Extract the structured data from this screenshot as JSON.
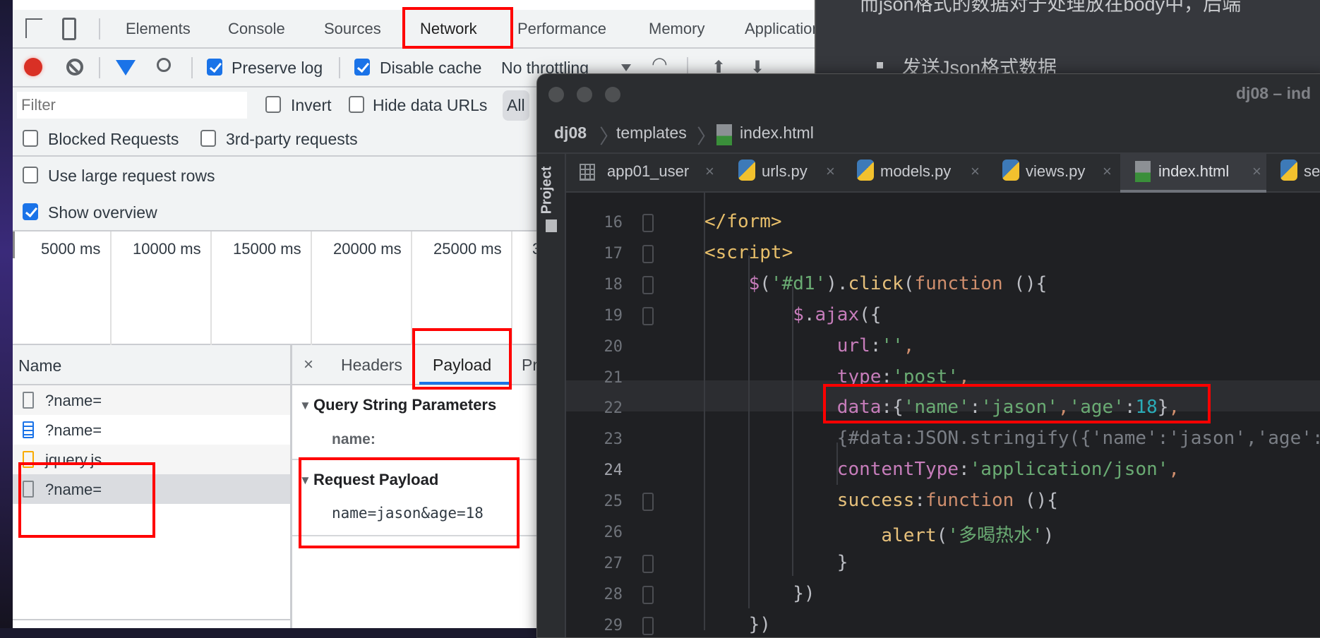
{
  "devtools": {
    "tabs": [
      "Elements",
      "Console",
      "Sources",
      "Network",
      "Performance",
      "Memory",
      "Application"
    ],
    "active_tab": "Network",
    "toolbar": {
      "preserve_log": "Preserve log",
      "preserve_log_checked": true,
      "disable_cache": "Disable cache",
      "disable_cache_checked": true,
      "throttling": "No throttling"
    },
    "filter": {
      "placeholder": "Filter",
      "invert": "Invert",
      "hide_data_urls": "Hide data URLs",
      "all": "All"
    },
    "options": {
      "blocked": "Blocked Requests",
      "third_party": "3rd-party requests",
      "large_rows": "Use large request rows",
      "show_overview": "Show overview",
      "show_overview_checked": true
    },
    "timeline_ticks": [
      "5000 ms",
      "10000 ms",
      "15000 ms",
      "20000 ms",
      "25000 ms",
      "3"
    ],
    "name_header": "Name",
    "requests": [
      {
        "name": "?name=",
        "icon": "document-icon"
      },
      {
        "name": "?name=",
        "icon": "html-document-icon"
      },
      {
        "name": "jquery.js",
        "icon": "script-icon"
      },
      {
        "name": "?name=",
        "icon": "document-icon",
        "selected": true
      }
    ],
    "detail_tabs": [
      "Headers",
      "Payload",
      "Pr"
    ],
    "active_detail_tab": "Payload",
    "query_section": "Query String Parameters",
    "query_param": "name:",
    "payload_section": "Request Payload",
    "payload_value": "name=jason&age=18"
  },
  "doc": {
    "line1": "而json格式的数据对于处理放在body中，后端",
    "bullet": "发送Json格式数据"
  },
  "ide": {
    "title": "dj08 – ind",
    "breadcrumb": [
      "dj08",
      "templates",
      "index.html"
    ],
    "project_label": "Project",
    "tabs": [
      "app01_user",
      "urls.py",
      "models.py",
      "views.py",
      "index.html",
      "se"
    ],
    "active_tab": "index.html",
    "current_line": 24,
    "lines": [
      {
        "n": "16",
        "indent": 0,
        "tokens": [
          [
            "t-tag",
            "</form>"
          ]
        ]
      },
      {
        "n": "17",
        "indent": 0,
        "tokens": [
          [
            "t-tag",
            "<script>"
          ]
        ]
      },
      {
        "n": "18",
        "indent": 4,
        "tokens": [
          [
            "t-prop",
            "$"
          ],
          [
            "t-p",
            "("
          ],
          [
            "t-str",
            "'#d1'"
          ],
          [
            "t-p",
            ")."
          ],
          [
            "t-fn",
            "click"
          ],
          [
            "t-p",
            "("
          ],
          [
            "t-kw",
            "function"
          ],
          [
            "t-p",
            " (){"
          ]
        ]
      },
      {
        "n": "19",
        "indent": 8,
        "tokens": [
          [
            "t-prop",
            "$"
          ],
          [
            "t-p",
            "."
          ],
          [
            "t-prop",
            "ajax"
          ],
          [
            "t-p",
            "({"
          ]
        ]
      },
      {
        "n": "20",
        "indent": 12,
        "tokens": [
          [
            "t-prop",
            "url"
          ],
          [
            "t-p",
            ":"
          ],
          [
            "t-str",
            "''"
          ],
          [
            "t-kw",
            ","
          ]
        ]
      },
      {
        "n": "21",
        "indent": 12,
        "tokens": [
          [
            "t-prop",
            "type"
          ],
          [
            "t-p",
            ":"
          ],
          [
            "t-str",
            "'post'"
          ],
          [
            "t-kw",
            ","
          ]
        ]
      },
      {
        "n": "22",
        "indent": 12,
        "tokens": [
          [
            "t-prop",
            "data"
          ],
          [
            "t-p",
            ":{"
          ],
          [
            "t-str",
            "'name'"
          ],
          [
            "t-p",
            ":"
          ],
          [
            "t-str",
            "'jason'"
          ],
          [
            "t-kw",
            ","
          ],
          [
            "t-str",
            "'age'"
          ],
          [
            "t-p",
            ":"
          ],
          [
            "t-num",
            "18"
          ],
          [
            "t-p",
            "}"
          ],
          [
            "t-kw",
            ","
          ]
        ]
      },
      {
        "n": "23",
        "indent": 12,
        "tokens": [
          [
            "t-cm",
            "{#data:JSON.stringify({'name':'jason','age':"
          ]
        ]
      },
      {
        "n": "24",
        "indent": 12,
        "tokens": [
          [
            "t-prop",
            "contentType"
          ],
          [
            "t-p",
            ":"
          ],
          [
            "t-str",
            "'application/json'"
          ],
          [
            "t-kw",
            ","
          ]
        ]
      },
      {
        "n": "25",
        "indent": 12,
        "tokens": [
          [
            "t-fn",
            "success"
          ],
          [
            "t-p",
            ":"
          ],
          [
            "t-kw",
            "function"
          ],
          [
            "t-p",
            " (){"
          ]
        ]
      },
      {
        "n": "26",
        "indent": 16,
        "tokens": [
          [
            "t-fn",
            "alert"
          ],
          [
            "t-p",
            "("
          ],
          [
            "t-str",
            "'多喝热水'"
          ],
          [
            "t-p",
            ")"
          ]
        ]
      },
      {
        "n": "27",
        "indent": 12,
        "tokens": [
          [
            "t-p",
            "}"
          ]
        ]
      },
      {
        "n": "28",
        "indent": 8,
        "tokens": [
          [
            "t-p",
            "})"
          ]
        ]
      },
      {
        "n": "29",
        "indent": 4,
        "tokens": [
          [
            "t-p",
            "})"
          ]
        ]
      }
    ]
  },
  "colors": {
    "annotation_red": "#ff0000",
    "accent_blue": "#1a73e8",
    "record_red": "#d93025"
  }
}
